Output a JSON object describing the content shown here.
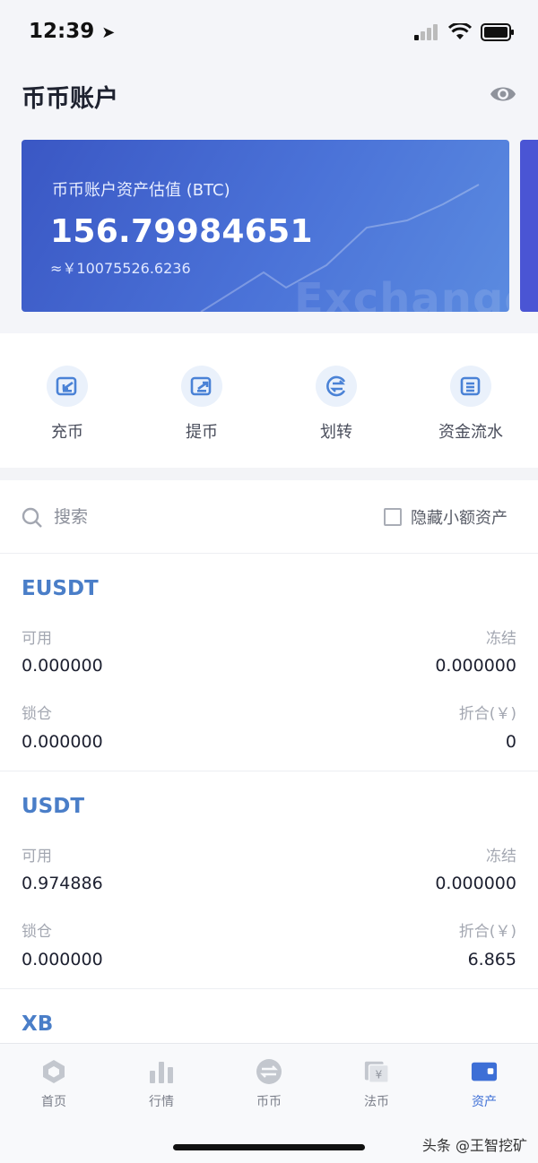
{
  "status": {
    "time": "12:39"
  },
  "header": {
    "title": "币币账户"
  },
  "card": {
    "label": "币币账户资产估值 (BTC)",
    "value": "156.79984651",
    "fiat": "≈￥10075526.6236",
    "watermark": "Exchange"
  },
  "actions": [
    {
      "label": "充币",
      "icon": "deposit-icon"
    },
    {
      "label": "提币",
      "icon": "withdraw-icon"
    },
    {
      "label": "划转",
      "icon": "transfer-icon"
    },
    {
      "label": "资金流水",
      "icon": "ledger-icon"
    }
  ],
  "search": {
    "placeholder": "搜索",
    "hide_small_label": "隐藏小额资产"
  },
  "assets": [
    {
      "name": "EUSDT",
      "available_label": "可用",
      "available": "0.000000",
      "frozen_label": "冻结",
      "frozen": "0.000000",
      "locked_label": "锁仓",
      "locked": "0.000000",
      "converted_label": "折合(￥)",
      "converted": "0"
    },
    {
      "name": "USDT",
      "available_label": "可用",
      "available": "0.974886",
      "frozen_label": "冻结",
      "frozen": "0.000000",
      "locked_label": "锁仓",
      "locked": "0.000000",
      "converted_label": "折合(￥)",
      "converted": "6.865"
    },
    {
      "name": "XB"
    }
  ],
  "tabbar": {
    "tabs": [
      {
        "label": "首页",
        "icon": "home-icon"
      },
      {
        "label": "行情",
        "icon": "market-icon"
      },
      {
        "label": "币币",
        "icon": "exchange-icon"
      },
      {
        "label": "法币",
        "icon": "fiat-icon"
      },
      {
        "label": "资产",
        "icon": "wallet-icon"
      }
    ],
    "active": "资产"
  },
  "watermark": "头条 @王智挖矿",
  "colors": {
    "accent": "#3d6fd6",
    "card_start": "#3a57c4",
    "card_end": "#5b8be0",
    "asset_name": "#4a7ec8"
  }
}
